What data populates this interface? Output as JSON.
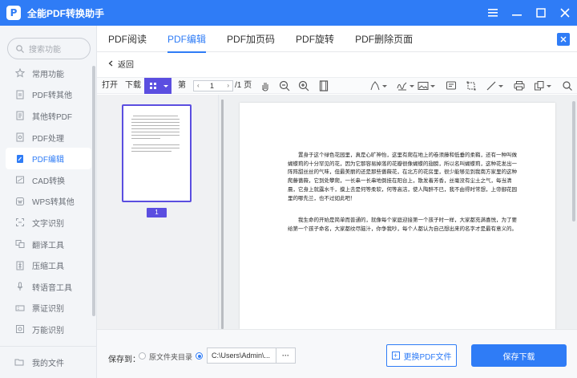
{
  "app": {
    "title": "全能PDF转换助手",
    "logo_letter": "P"
  },
  "sidebar": {
    "search_placeholder": "搜索功能",
    "items": [
      {
        "label": "常用功能",
        "icon": "star-icon"
      },
      {
        "label": "PDF转其他",
        "icon": "pdf-export-icon"
      },
      {
        "label": "其他转PDF",
        "icon": "pdf-import-icon"
      },
      {
        "label": "PDF处理",
        "icon": "pdf-process-icon"
      },
      {
        "label": "PDF编辑",
        "icon": "pdf-edit-icon",
        "active": true
      },
      {
        "label": "CAD转换",
        "icon": "cad-icon"
      },
      {
        "label": "WPS转其他",
        "icon": "wps-icon"
      },
      {
        "label": "文字识别",
        "icon": "ocr-icon"
      },
      {
        "label": "翻译工具",
        "icon": "translate-icon"
      },
      {
        "label": "压缩工具",
        "icon": "compress-icon"
      },
      {
        "label": "转语音工具",
        "icon": "voice-icon"
      },
      {
        "label": "票证识别",
        "icon": "ticket-icon"
      },
      {
        "label": "万能识别",
        "icon": "universal-icon"
      }
    ],
    "bottom_label": "我的文件"
  },
  "tabs": [
    {
      "label": "PDF阅读"
    },
    {
      "label": "PDF编辑",
      "active": true
    },
    {
      "label": "PDF加页码"
    },
    {
      "label": "PDF旋转"
    },
    {
      "label": "PDF删除页面"
    }
  ],
  "back_label": "返回",
  "toolbar": {
    "open": "打开",
    "download": "下载",
    "page_prefix": "第",
    "page_value": "1",
    "page_total": "/1 页"
  },
  "thumbnail": {
    "page_number": "1"
  },
  "document": {
    "paragraphs": [
      "置身于这个绿色花园里，真是心旷神怡，这里有爬在地上的卷须藤和低垂的柔鞘，还有一种叫做蝴蝶莉的十分罕见的花，因为它那容易掉落的花瓣很像蝴蝶的翅膀，所以名叫蝴蝶莉，这种花发出一阵阵甜丝丝的气味，但最美丽的还是那些蔷薇花，在北方的花房里，很少能够见到我南方家里的这种爬藤蔷薇，它到处攀爬，一长串一长串地倒挂在阳台上，散发着芳香，丝毫没有尘土之气，每当清晨，它身上就露水千，摸上去是何等柔软，何等高洁，使人陶醉不已，我不由得时常想，上帝御花园里的哪先兰，也不过如此吧！",
      "我生命的开始是简单而普通的，就像每个家庭迎接第一个孩子时一样，大家都充满喜悦，为了要给第一个孩子命名，大家都纹尽脑汁，你争我吵，每个人都认为自己想出来的名字才是最有意义的。"
    ]
  },
  "bottom": {
    "save_to": "保存到：",
    "option_original": "原文件夹目录",
    "path": "C:\\Users\\Admin\\...",
    "dots": "···",
    "replace_label": "更换PDF文件",
    "save_label": "保存下载"
  },
  "colors": {
    "accent": "#2f7cf6",
    "highlight": "#5b4ee0"
  }
}
